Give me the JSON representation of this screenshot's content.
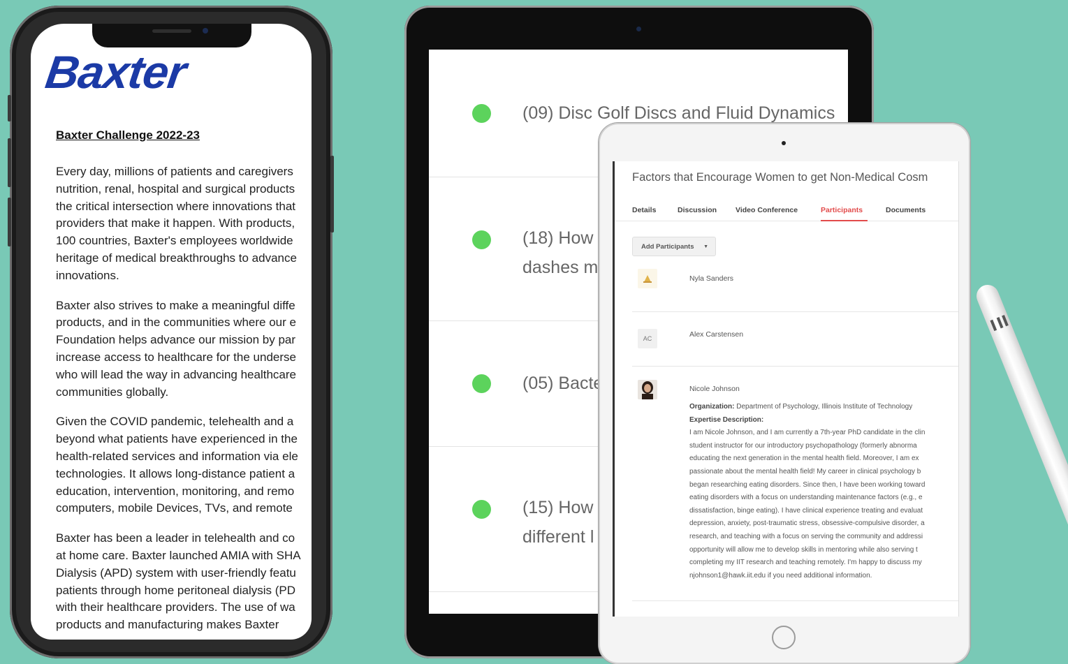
{
  "phone": {
    "logo": "Baxter",
    "title": "Baxter Challenge 2022-23",
    "paragraphs": [
      [
        "Every day, millions of patients and caregivers",
        "nutrition, renal, hospital and surgical products",
        "the critical intersection where innovations that",
        "providers that make it happen. With products,",
        "100 countries, Baxter's employees worldwide",
        "heritage of medical breakthroughs to advance",
        "innovations."
      ],
      [
        "Baxter also strives to make a meaningful diffe",
        "products, and in the communities where our e",
        "Foundation helps advance our mission by par",
        "increase access to healthcare for the underse",
        "who will lead the way in advancing healthcare",
        "communities globally."
      ],
      [
        "Given the COVID pandemic, telehealth and a",
        "beyond what patients have experienced in the",
        "health-related services and information via ele",
        "technologies. It allows long-distance patient a",
        "education, intervention, monitoring, and remo",
        "computers, mobile Devices, TVs, and remote"
      ],
      [
        "Baxter has been a leader in telehealth and co",
        "at home care. Baxter launched AMIA with SHA",
        "Dialysis (APD) system with user-friendly featu",
        "patients through home peritoneal dialysis (PD",
        "with their healthcare providers. The use of wa",
        "products and manufacturing makes Baxter"
      ]
    ]
  },
  "ipad": {
    "projects": [
      {
        "title": "(09) Disc Golf Discs and Fluid Dynamics",
        "title2": ""
      },
      {
        "title": "(18) How m",
        "title2": "dashes m"
      },
      {
        "title": "(05) Bacte",
        "title2": ""
      },
      {
        "title": "(15) How t",
        "title2": "different l"
      }
    ],
    "status_color": "#5cd35c"
  },
  "mini": {
    "title": "Factors that Encourage Women to get Non-Medical Cosm",
    "tabs": [
      "Details",
      "Discussion",
      "Video Conference",
      "Participants",
      "Documents"
    ],
    "active_tab": "Participants",
    "add_button": "Add Participants",
    "accent": "#e24b4b",
    "participants": [
      {
        "name": "Nyla Sanders",
        "avatar": "user-icon"
      },
      {
        "name": "Alex Carstensen",
        "initials": "AC"
      },
      {
        "name": "Nicole Johnson",
        "org_label": "Organization:",
        "org_value": "Department of Psychology, Illinois Institute of Technology",
        "exp_label": "Expertise Description:",
        "description_lines": [
          "I am Nicole Johnson, and I am currently a 7th-year PhD candidate in the clin",
          "student instructor for our introductory psychopathology (formerly abnorma",
          "educating the next generation in the mental health field. Moreover, I am ex",
          "passionate about the mental health field! My career in clinical psychology b",
          "began researching eating disorders. Since then, I have been working toward",
          "eating disorders with a focus on understanding maintenance factors (e.g., e",
          "dissatisfaction, binge eating). I have clinical experience treating and evaluat",
          "depression, anxiety, post-traumatic stress, obsessive-compulsive disorder, a",
          "research, and teaching with a focus on serving the community and addressi",
          "opportunity will allow me to develop skills in mentoring while also serving t",
          "completing my IIT research and teaching remotely. I'm happy to discuss my",
          "njohnson1@hawk.iit.edu if you need additional information."
        ]
      }
    ]
  }
}
